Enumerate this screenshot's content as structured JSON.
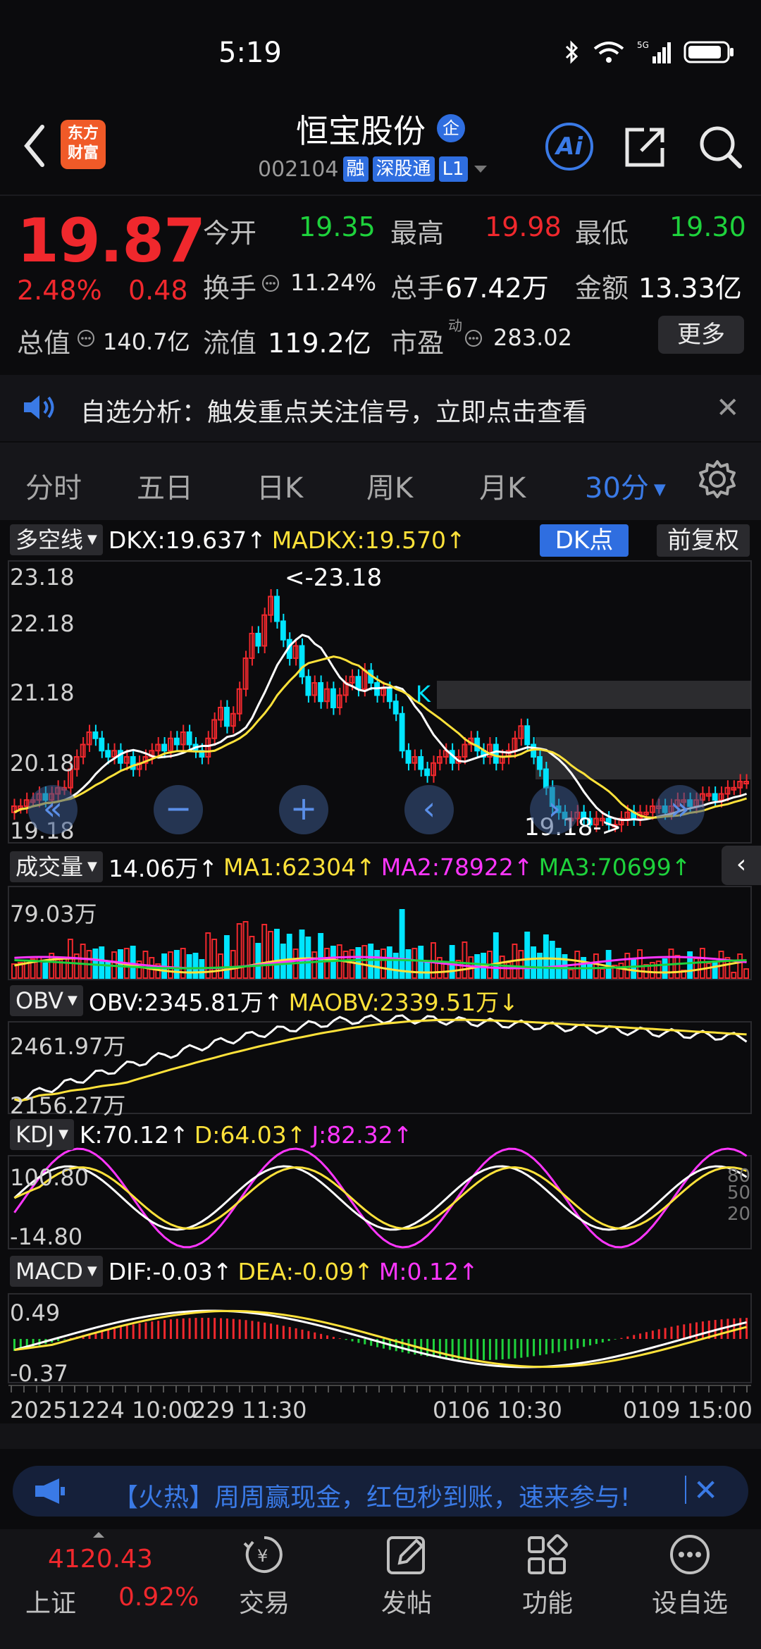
{
  "status": {
    "time": "5:19"
  },
  "header": {
    "logo_text": [
      "东方",
      "财富"
    ],
    "name": "恒宝股份",
    "name_badge": "企",
    "code": "002104",
    "tags": [
      "融",
      "深股通",
      "L1"
    ],
    "ai_label": "Ai"
  },
  "quote": {
    "price": "19.87",
    "change_pct": "2.48%",
    "change": "0.48",
    "open_label": "今开",
    "open": "19.35",
    "high_label": "最高",
    "high": "19.98",
    "low_label": "最低",
    "low": "19.30",
    "turnover_label": "换手",
    "turnover": "11.24%",
    "volume_label": "总手",
    "volume": "67.42万",
    "amount_label": "金额",
    "amount": "13.33亿",
    "mcap_label": "总值",
    "mcap": "140.7亿",
    "float_label": "流值",
    "float": "119.2亿",
    "pe_label": "市盈",
    "pe_sup": "动",
    "pe": "283.02",
    "more": "更多"
  },
  "notice": {
    "text": "自选分析：触发重点关注信号，立即点击查看"
  },
  "tabs": [
    "分时",
    "五日",
    "日K",
    "周K",
    "月K",
    "30分"
  ],
  "main_chart": {
    "indicator": "多空线",
    "dkx": "DKX:19.637↑",
    "madkx": "MADKX:19.570↑",
    "dk_btn": "DK点",
    "fq_btn": "前复权",
    "y_labels": [
      "23.18",
      "22.18",
      "21.18",
      "20.18",
      "19.18"
    ],
    "max_marker": "<-23.18",
    "min_marker": "19.18->",
    "k_marker": "K"
  },
  "volume": {
    "indicator": "成交量",
    "vol": "14.06万↑",
    "ma1": "MA1:62304↑",
    "ma2": "MA2:78922↑",
    "ma3": "MA3:70699↑",
    "y_label": "79.03万"
  },
  "obv": {
    "indicator": "OBV",
    "obv": "OBV:2345.81万↑",
    "maobv": "MAOBV:2339.51万↓",
    "y_top": "2461.97万",
    "y_bottom": "2156.27万"
  },
  "kdj": {
    "indicator": "KDJ",
    "k": "K:70.12↑",
    "d": "D:64.03↑",
    "j": "J:82.32↑",
    "y_top": "100.80",
    "y_bottom": "-14.80",
    "right_top": "80",
    "right_mid": "50",
    "right_bottom": "20"
  },
  "macd": {
    "indicator": "MACD",
    "dif": "DIF:-0.03↑",
    "dea": "DEA:-0.09↑",
    "m": "M:0.12↑",
    "y_top": "0.49",
    "y_bottom": "-0.37"
  },
  "time_axis": [
    "20251224 10:00",
    "229 11:30",
    "0106 10:30",
    "0109 15:00"
  ],
  "promo": {
    "text": "【火热】周周赢现金，红包秒到账，速来参与!"
  },
  "bottom": {
    "index_value": "4120.43",
    "index_name": "上证",
    "index_pct": "0.92%",
    "nav": [
      "交易",
      "发帖",
      "功能",
      "设自选"
    ]
  },
  "colors": {
    "up": "#f0282d",
    "down": "#00e5ff",
    "accent": "#3a7ae6",
    "yellow": "#ffe23a",
    "magenta": "#ff36ff",
    "green": "#1ed23c"
  }
}
